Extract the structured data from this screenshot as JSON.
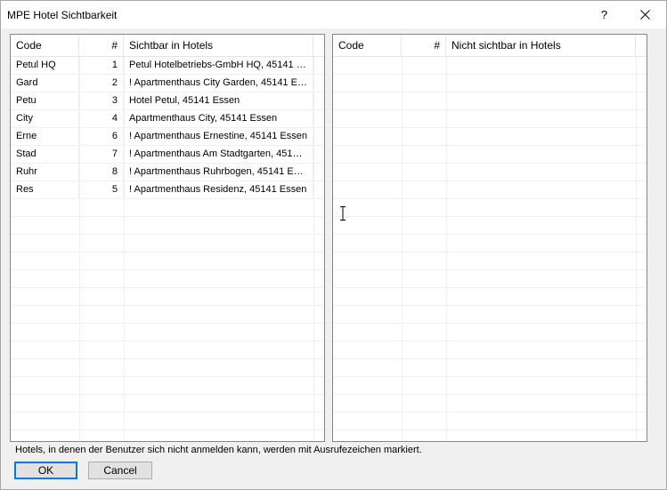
{
  "window": {
    "title": "MPE Hotel Sichtbarkeit",
    "help_label": "?",
    "close_icon": "close-icon"
  },
  "visible_panel": {
    "columns": {
      "code": "Code",
      "num": "#",
      "name": "Sichtbar in Hotels"
    },
    "rows": [
      {
        "code": "Petul HQ",
        "num": "1",
        "name": "Petul Hotelbetriebs-GmbH HQ, 45141 E..."
      },
      {
        "code": "Gard",
        "num": "2",
        "name": "! Apartmenthaus City Garden, 45141 Es..."
      },
      {
        "code": "Petu",
        "num": "3",
        "name": "Hotel Petul, 45141 Essen"
      },
      {
        "code": "City",
        "num": "4",
        "name": "Apartmenthaus City, 45141 Essen"
      },
      {
        "code": "Erne",
        "num": "6",
        "name": "! Apartmenthaus Ernestine, 45141 Essen"
      },
      {
        "code": "Stad",
        "num": "7",
        "name": "! Apartmenthaus Am Stadtgarten, 45141..."
      },
      {
        "code": "Ruhr",
        "num": "8",
        "name": "! Apartmenthaus Ruhrbogen, 45141 Essen"
      },
      {
        "code": "Res",
        "num": "5",
        "name": "! Apartmenthaus Residenz, 45141 Essen"
      }
    ]
  },
  "hidden_panel": {
    "columns": {
      "code": "Code",
      "num": "#",
      "name": "Nicht sichtbar in Hotels"
    },
    "rows": []
  },
  "footer": {
    "note": "Hotels, in denen der Benutzer sich nicht anmelden kann, werden mit Ausrufezeichen markiert.",
    "ok_label": "OK",
    "cancel_label": "Cancel"
  }
}
